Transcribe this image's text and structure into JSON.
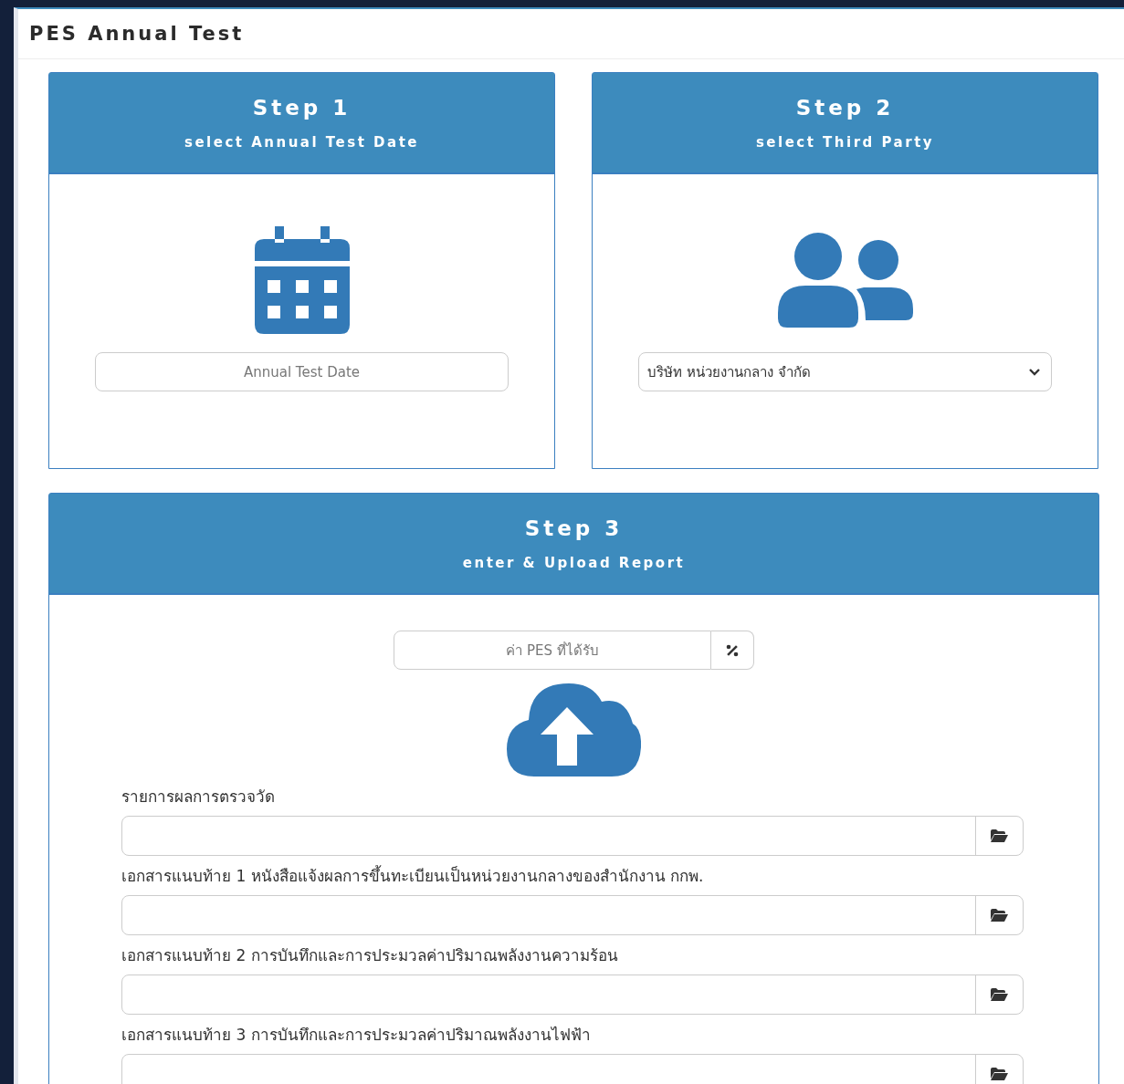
{
  "page": {
    "title": "PES Annual Test"
  },
  "steps": [
    {
      "title": "Step 1",
      "subtitle": "select Annual Test Date",
      "kind": "date",
      "placeholder": "Annual Test Date"
    },
    {
      "title": "Step 2",
      "subtitle": "select Third Party",
      "kind": "party",
      "value": "บริษัท หน่วยงานกลาง จำกัด"
    }
  ],
  "step3": {
    "title": "Step 3",
    "subtitle": "enter & Upload Report",
    "pes_field": {
      "placeholder": "ค่า PES ที่ได้รับ"
    },
    "uploads": [
      {
        "label": "รายการผลการตรวจวัด"
      },
      {
        "label": "เอกสารแนบท้าย 1 หนังสือแจ้งผลการขึ้นทะเบียนเป็นหน่วยงานกลางของสำนักงาน กกพ."
      },
      {
        "label": "เอกสารแนบท้าย 2 การบันทึกและการประมวลค่าปริมาณพลังงานความร้อน"
      },
      {
        "label": "เอกสารแนบท้าย 3 การบันทึกและการประมวลค่าปริมาณพลังงานไฟฟ้า"
      }
    ]
  }
}
